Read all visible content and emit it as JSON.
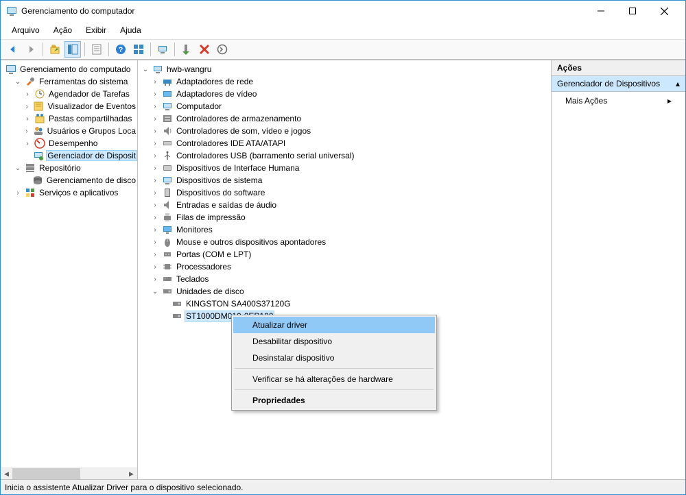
{
  "window": {
    "title": "Gerenciamento do computador"
  },
  "menu": {
    "arquivo": "Arquivo",
    "acao": "Ação",
    "exibir": "Exibir",
    "ajuda": "Ajuda"
  },
  "leftTree": {
    "root": "Gerenciamento do computado",
    "ferramentas": "Ferramentas do sistema",
    "agendador": "Agendador de Tarefas",
    "visualizador": "Visualizador de Eventos",
    "pastas": "Pastas compartilhadas",
    "usuarios": "Usuários e Grupos Loca",
    "desempenho": "Desempenho",
    "gerenciador": "Gerenciador de Disposit",
    "repositorio": "Repositório",
    "gerenciamento_disco": "Gerenciamento de disco",
    "servicos": "Serviços e aplicativos"
  },
  "midTree": {
    "root": "hwb-wangru",
    "adaptadores_rede": "Adaptadores de rede",
    "adaptadores_video": "Adaptadores de vídeo",
    "computador": "Computador",
    "ctrl_armazenamento": "Controladores de armazenamento",
    "ctrl_som": "Controladores de som, vídeo e jogos",
    "ctrl_ide": "Controladores IDE ATA/ATAPI",
    "ctrl_usb": "Controladores USB (barramento serial universal)",
    "dispositivos_interface": "Dispositivos de Interface Humana",
    "dispositivos_sistema": "Dispositivos de sistema",
    "dispositivos_software": "Dispositivos do software",
    "entradas_saidas": "Entradas e saídas de áudio",
    "filas_impressao": "Filas de impressão",
    "monitores": "Monitores",
    "mouse": "Mouse e outros dispositivos apontadores",
    "portas": "Portas (COM e LPT)",
    "processadores": "Processadores",
    "teclados": "Teclados",
    "unidades_disco": "Unidades de disco",
    "disk1": "KINGSTON SA400S37120G",
    "disk2": "ST1000DM010-2EP102"
  },
  "actions": {
    "header": "Ações",
    "sub": "Gerenciador de Dispositivos",
    "more": "Mais Ações"
  },
  "ctx": {
    "atualizar": "Atualizar driver",
    "desabilitar": "Desabilitar dispositivo",
    "desinstalar": "Desinstalar dispositivo",
    "verificar": "Verificar se há alterações de hardware",
    "propriedades": "Propriedades"
  },
  "status": "Inicia o assistente Atualizar Driver para o dispositivo selecionado."
}
